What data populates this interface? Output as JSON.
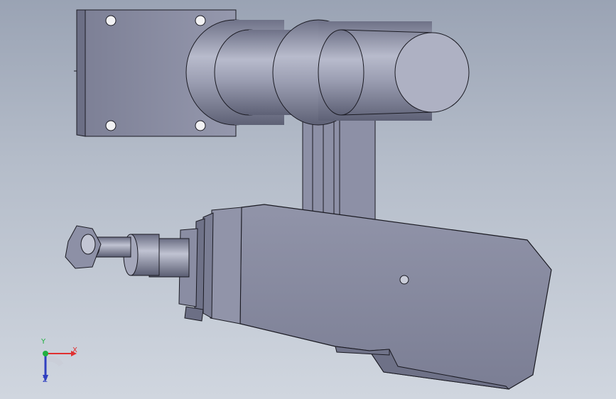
{
  "viewport": {
    "background_top": "#9aa3b4",
    "background_bottom": "#d0d6df"
  },
  "model": {
    "part_color": "#8d90a6",
    "part_dark": "#5f6278",
    "part_light": "#b9bccd",
    "edge_color": "#1a1a22"
  },
  "triad": {
    "x_label": "X",
    "y_label": "Y",
    "z_label": "Z",
    "x_color": "#e03030",
    "y_color": "#20b040",
    "z_color": "#3040c0"
  }
}
